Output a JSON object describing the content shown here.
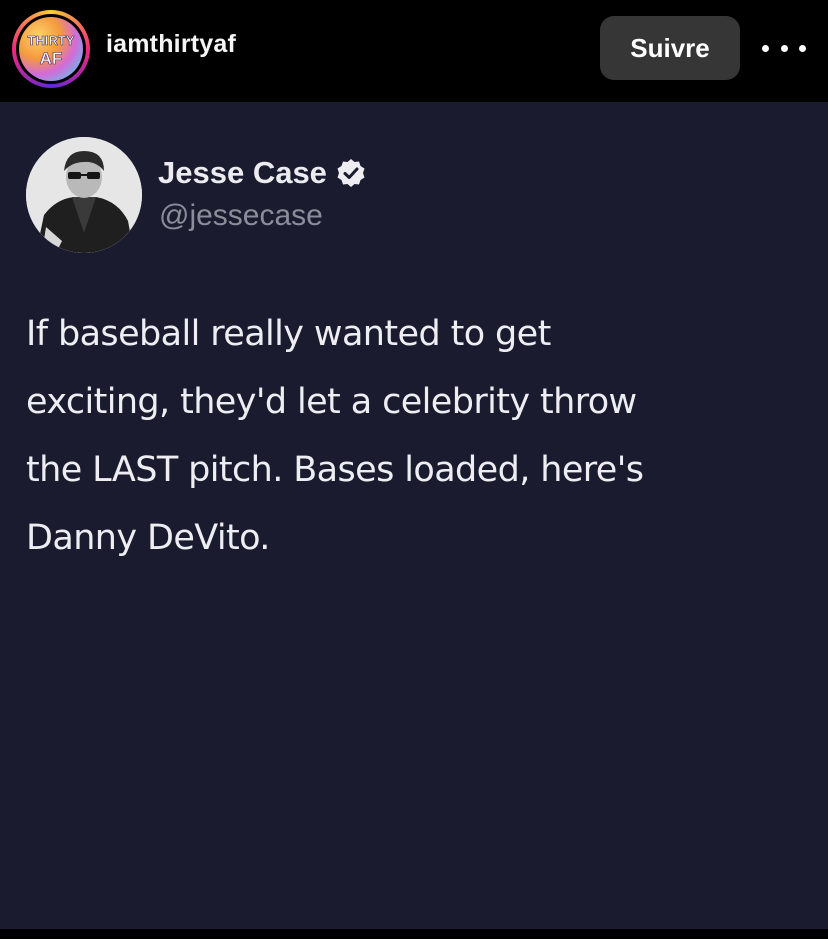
{
  "post_header": {
    "avatar_logo_text": [
      "THIRTY",
      "AF"
    ],
    "username": "iamthirtyaf",
    "follow_label": "Suivre",
    "more_icon": "more-horizontal-icon"
  },
  "tweet": {
    "author_name": "Jesse Case",
    "handle": "@jessecase",
    "verified_icon": "verified-badge-icon",
    "text_lines": [
      "If baseball really wanted to get",
      "exciting, they'd let a celebrity throw",
      "the LAST pitch. Bases loaded, here's",
      "Danny DeVito."
    ]
  },
  "colors": {
    "header_bg": "#000000",
    "post_bg": "#1a1b2e",
    "button_bg": "#363636",
    "handle_color": "#8b8e99",
    "text_color": "#ededf2"
  }
}
